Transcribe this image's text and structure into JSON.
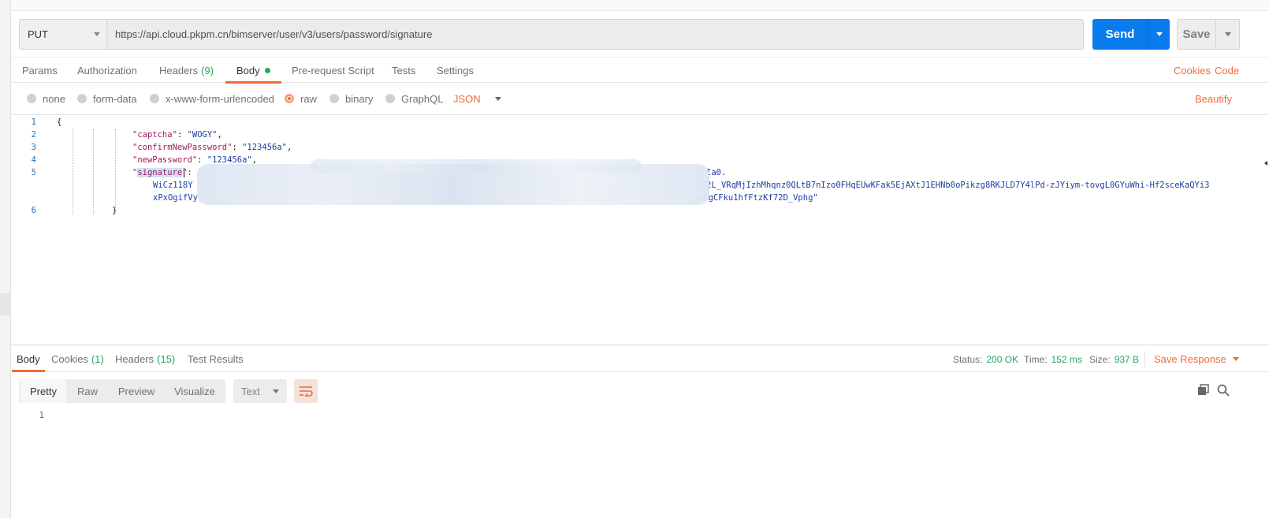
{
  "request": {
    "method": "PUT",
    "url": "https://api.cloud.pkpm.cn/bimserver/user/v3/users/password/signature",
    "send_label": "Send",
    "save_label": "Save"
  },
  "request_tabs": [
    {
      "label": "Params"
    },
    {
      "label": "Authorization"
    },
    {
      "label": "Headers",
      "count": "(9)"
    },
    {
      "label": "Body"
    },
    {
      "label": "Pre-request Script"
    },
    {
      "label": "Tests"
    },
    {
      "label": "Settings"
    }
  ],
  "request_links": {
    "cookies": "Cookies",
    "code": "Code"
  },
  "body_types": [
    "none",
    "form-data",
    "x-www-form-urlencoded",
    "raw",
    "binary",
    "GraphQL"
  ],
  "body_format": "JSON",
  "beautify_label": "Beautify",
  "editor": {
    "line_numbers": [
      "1",
      "2",
      "3",
      "4",
      "5",
      "6"
    ],
    "open_brace": "{",
    "close_brace": "}",
    "lines": [
      {
        "key": "\"captcha\"",
        "value": "\"WOGY\"",
        "trail": ","
      },
      {
        "key": "\"confirmNewPassword\"",
        "value": "\"123456a\"",
        "trail": ","
      },
      {
        "key": "\"newPassword\"",
        "value": "\"123456a\"",
        "trail": ","
      }
    ],
    "sig_quote_open": "\"",
    "sig_key": "signature",
    "sig_after_key": "\": \"",
    "sig_line1_tail": "Ia0.",
    "sig_line2_head": "WiCz118Y",
    "sig_line2_tail": "2L_VRqMjIzhMhqnz0QLtB7nIzo0FHqEUwKFak5EjAXtJ1EHNb0oPikzg8RKJLD7Y4lPd-zJYiym-tovgL0GYuWhi-Hf2sceKaQYi3",
    "sig_line3_head": "xPxOgifVy",
    "sig_line3_tail": "wCgCFku1hfFtzKf72D_Vphg\""
  },
  "response_tabs": [
    {
      "label": "Body"
    },
    {
      "label": "Cookies",
      "count": "(1)"
    },
    {
      "label": "Headers",
      "count": "(15)"
    },
    {
      "label": "Test Results"
    }
  ],
  "response_status": {
    "status_label": "Status:",
    "status_value": "200 OK",
    "time_label": "Time:",
    "time_value": "152 ms",
    "size_label": "Size:",
    "size_value": "937 B"
  },
  "save_response_label": "Save Response",
  "view_modes": [
    "Pretty",
    "Raw",
    "Preview",
    "Visualize"
  ],
  "response_format": "Text",
  "response_body": {
    "line_numbers": [
      "1"
    ]
  },
  "colors": {
    "accent": "#f26b3a",
    "send": "#097bed",
    "success": "#26a65b"
  }
}
